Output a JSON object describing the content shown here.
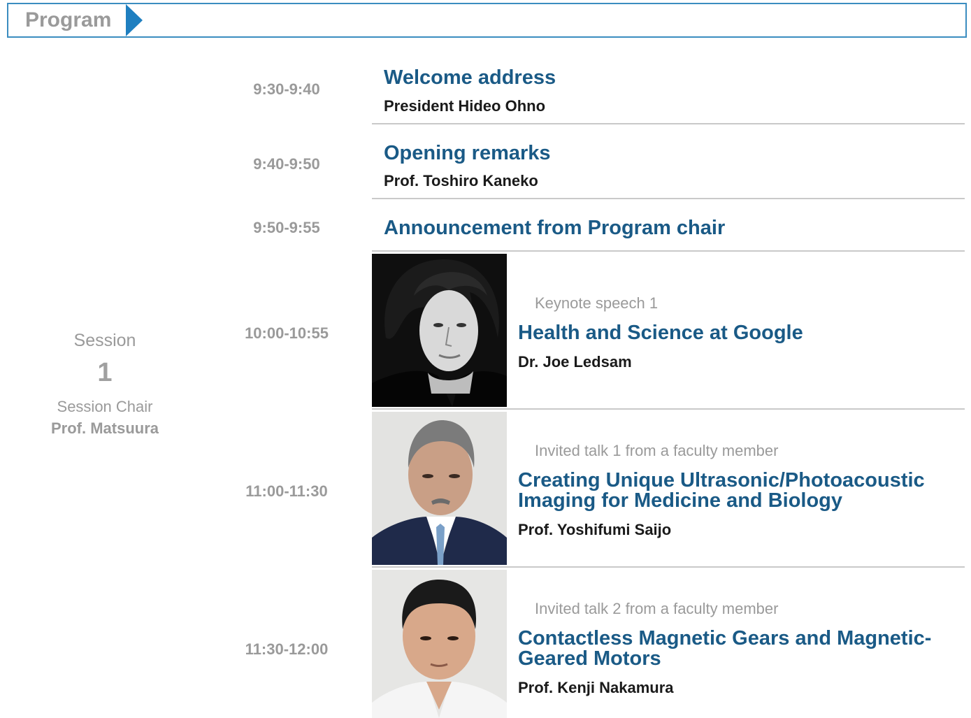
{
  "header": {
    "title": "Program"
  },
  "session": {
    "label": "Session",
    "number": "1",
    "chair_label": "Session Chair",
    "chair_name": "Prof. Matsuura"
  },
  "items": [
    {
      "time": "9:30-9:40",
      "title": "Welcome address",
      "speaker": "President Hideo Ohno"
    },
    {
      "time": "9:40-9:50",
      "title": "Opening remarks",
      "speaker": "Prof. Toshiro Kaneko"
    },
    {
      "time": "9:50-9:55",
      "title": "Announcement from Program chair"
    },
    {
      "time": "10:00-10:55",
      "category": "Keynote speech 1",
      "title": "Health and Science at Google",
      "speaker": "Dr. Joe Ledsam"
    },
    {
      "time": "11:00-11:30",
      "category": "Invited talk 1 from a faculty member",
      "title_line1": "Creating Unique Ultrasonic/Photoacoustic",
      "title_line2": "Imaging for Medicine and Biology",
      "speaker": "Prof. Yoshifumi Saijo"
    },
    {
      "time": "11:30-12:00",
      "category": "Invited talk 2 from a faculty member",
      "title_line1": "Contactless Magnetic Gears and Magnetic-",
      "title_line2": "Geared Motors",
      "speaker": "Prof. Kenji Nakamura"
    }
  ]
}
